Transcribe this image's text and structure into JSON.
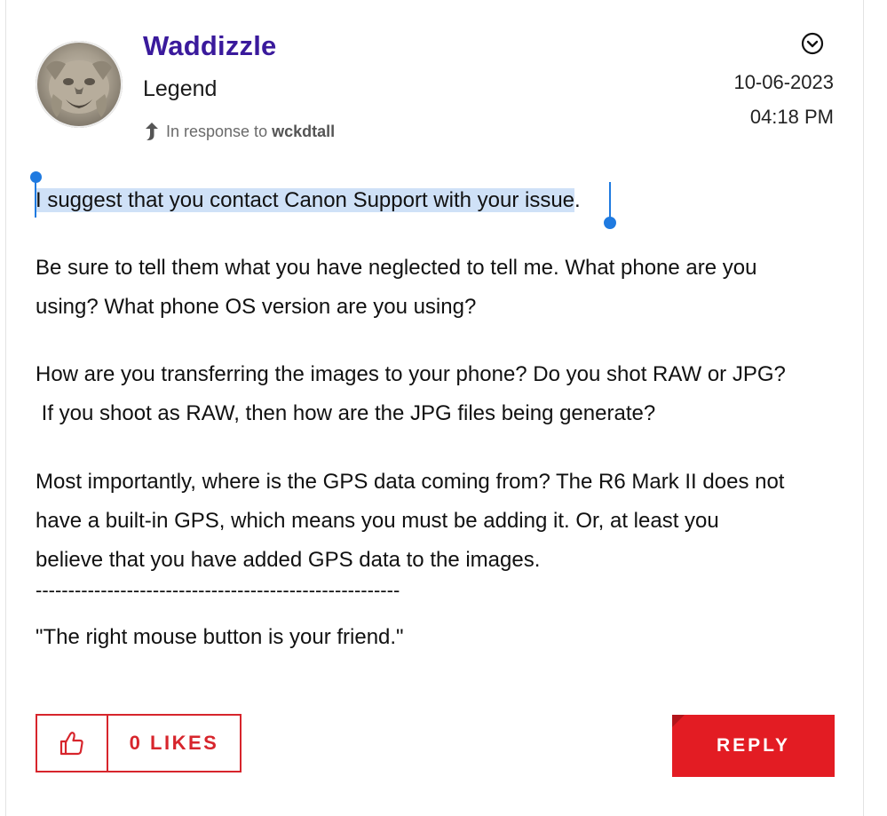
{
  "post": {
    "author": {
      "username": "Waddizzle",
      "rank": "Legend",
      "avatar_icon": "gargoyle-avatar"
    },
    "in_response": {
      "prefix": "In response to",
      "target": "wckdtall"
    },
    "date": "10-06-2023",
    "time": "04:18 PM",
    "options_icon": "chevron-down-circle-icon",
    "body": {
      "p1_selected": "I suggest that you contact Canon Support with your issue",
      "p1_tail": ".",
      "p2_line1": "Be sure to tell them what you have neglected to tell me.  What phone are you",
      "p2_line2": "using?  What phone OS version are you using?",
      "p3_line1": "How are you transferring the images to your phone?  Do you shot RAW or JPG?",
      "p3_line2": " If you shoot as RAW, then how are the JPG files being generate?",
      "p4_line1": "Most importantly, where is the GPS data coming from?  The R6 Mark II does not",
      "p4_line2": "have a built-in GPS, which means you must be adding it.  Or, at least you",
      "p4_line3": "believe that you have added GPS data to the images.",
      "divider": "--------------------------------------------------------",
      "signature": "\"The right mouse button is your friend.\""
    },
    "actions": {
      "like_icon": "thumbs-up-icon",
      "likes_label": "0 LIKES",
      "reply_label": "REPLY"
    }
  },
  "colors": {
    "username": "#3a1a9c",
    "accent_red": "#e31c23",
    "selection": "#cfe1f7",
    "selection_handle": "#1f7ae0"
  }
}
